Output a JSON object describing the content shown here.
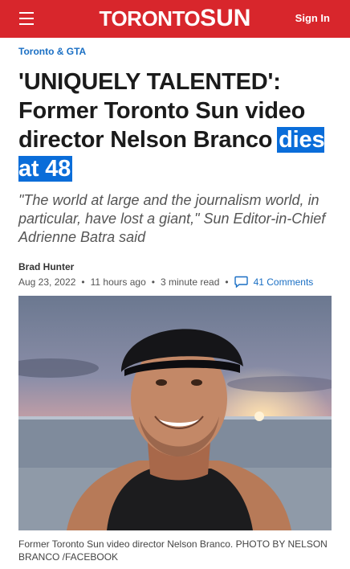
{
  "header": {
    "logo_left": "TORONTO",
    "logo_right": "SUN",
    "signin_label": "Sign In",
    "brand_color": "#d8262c"
  },
  "article": {
    "category": "Toronto & GTA",
    "headline_main": "'UNIQUELY TALENTED': Former Toronto Sun video director Nelson Branco",
    "headline_highlight": "dies at 48",
    "subhead": "\"The world at large and the journalism world, in particular, have lost a giant,\" Sun Editor-in-Chief Adrienne Batra said",
    "author": "Brad Hunter",
    "date": "Aug 23, 2022",
    "time_ago": "11 hours ago",
    "read_time": "3 minute read",
    "comments_label": "41 Comments",
    "photo_icon": "portrait-photo",
    "caption": "Former Toronto Sun video director Nelson Branco. PHOTO BY NELSON BRANCO /FACEBOOK"
  }
}
